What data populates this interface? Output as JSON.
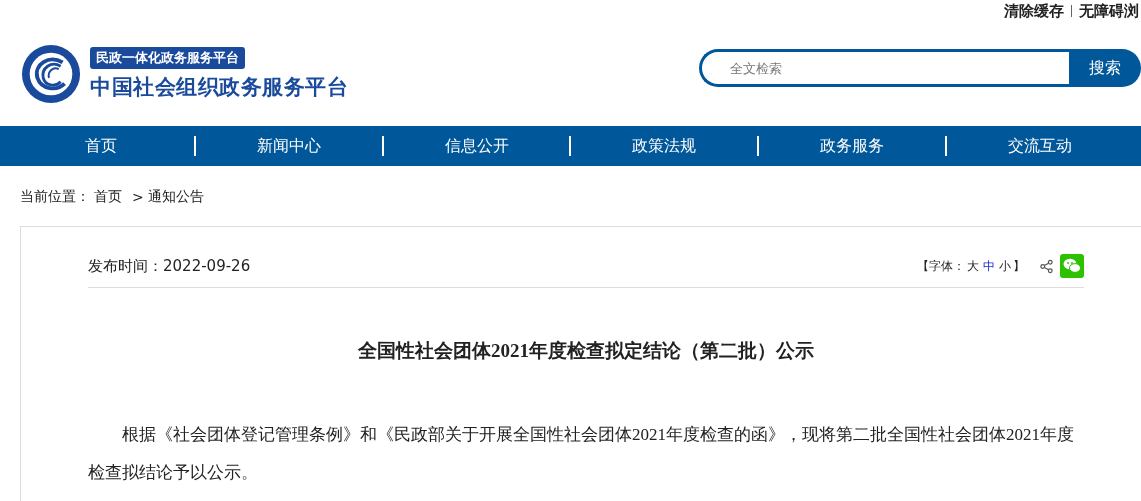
{
  "top_links": [
    "清除缓存",
    "无障碍浏"
  ],
  "logo": {
    "subtitle": "民政一体化政务服务平台",
    "title": "中国社会组织政务服务平台"
  },
  "search": {
    "placeholder": "全文检索",
    "button": "搜索"
  },
  "nav": [
    {
      "label": "首页"
    },
    {
      "label": "新闻中心"
    },
    {
      "label": "信息公开"
    },
    {
      "label": "政策法规"
    },
    {
      "label": "政务服务"
    },
    {
      "label": "交流互动"
    }
  ],
  "breadcrumb": {
    "label": "当前位置：",
    "items": [
      "首页",
      "通知公告"
    ],
    "separator": ">"
  },
  "article": {
    "date": "发布时间：2022-09-26",
    "font_size": {
      "open": "【字体：",
      "close": "】",
      "options": [
        {
          "label": "大",
          "selected": false
        },
        {
          "label": "中",
          "selected": true
        },
        {
          "label": "小",
          "selected": false
        }
      ]
    },
    "title": "全国性社会团体2021年度检查拟定结论（第二批）公示",
    "paragraphs": [
      "根据《社会团体登记管理条例》和《民政部关于开展全国性社会团体2021年度检查的函》，现将第二批全国性社会团体2021年度检查拟结论予以公示。"
    ]
  }
}
